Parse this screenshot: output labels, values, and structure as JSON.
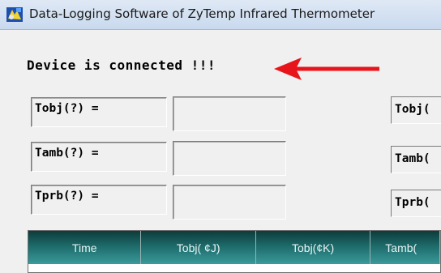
{
  "window": {
    "title": "Data-Logging Software of ZyTemp Infrared Thermometer",
    "app_icon": "app-icon"
  },
  "status": {
    "text": "Device is connected !!!",
    "arrow_color": "#e8141b"
  },
  "readings": [
    {
      "label": "Tobj(?) =",
      "value": ""
    },
    {
      "label": "Tamb(?) =",
      "value": ""
    },
    {
      "label": "Tprb(?) =",
      "value": ""
    }
  ],
  "readings_right": [
    {
      "label": "Tobj("
    },
    {
      "label": "Tamb("
    },
    {
      "label": "Tprb("
    }
  ],
  "grid": {
    "columns": [
      "Time",
      "Tobj( ¢J)",
      "Tobj(¢K)",
      "Tamb("
    ],
    "header_color": "#1d6a6a"
  }
}
